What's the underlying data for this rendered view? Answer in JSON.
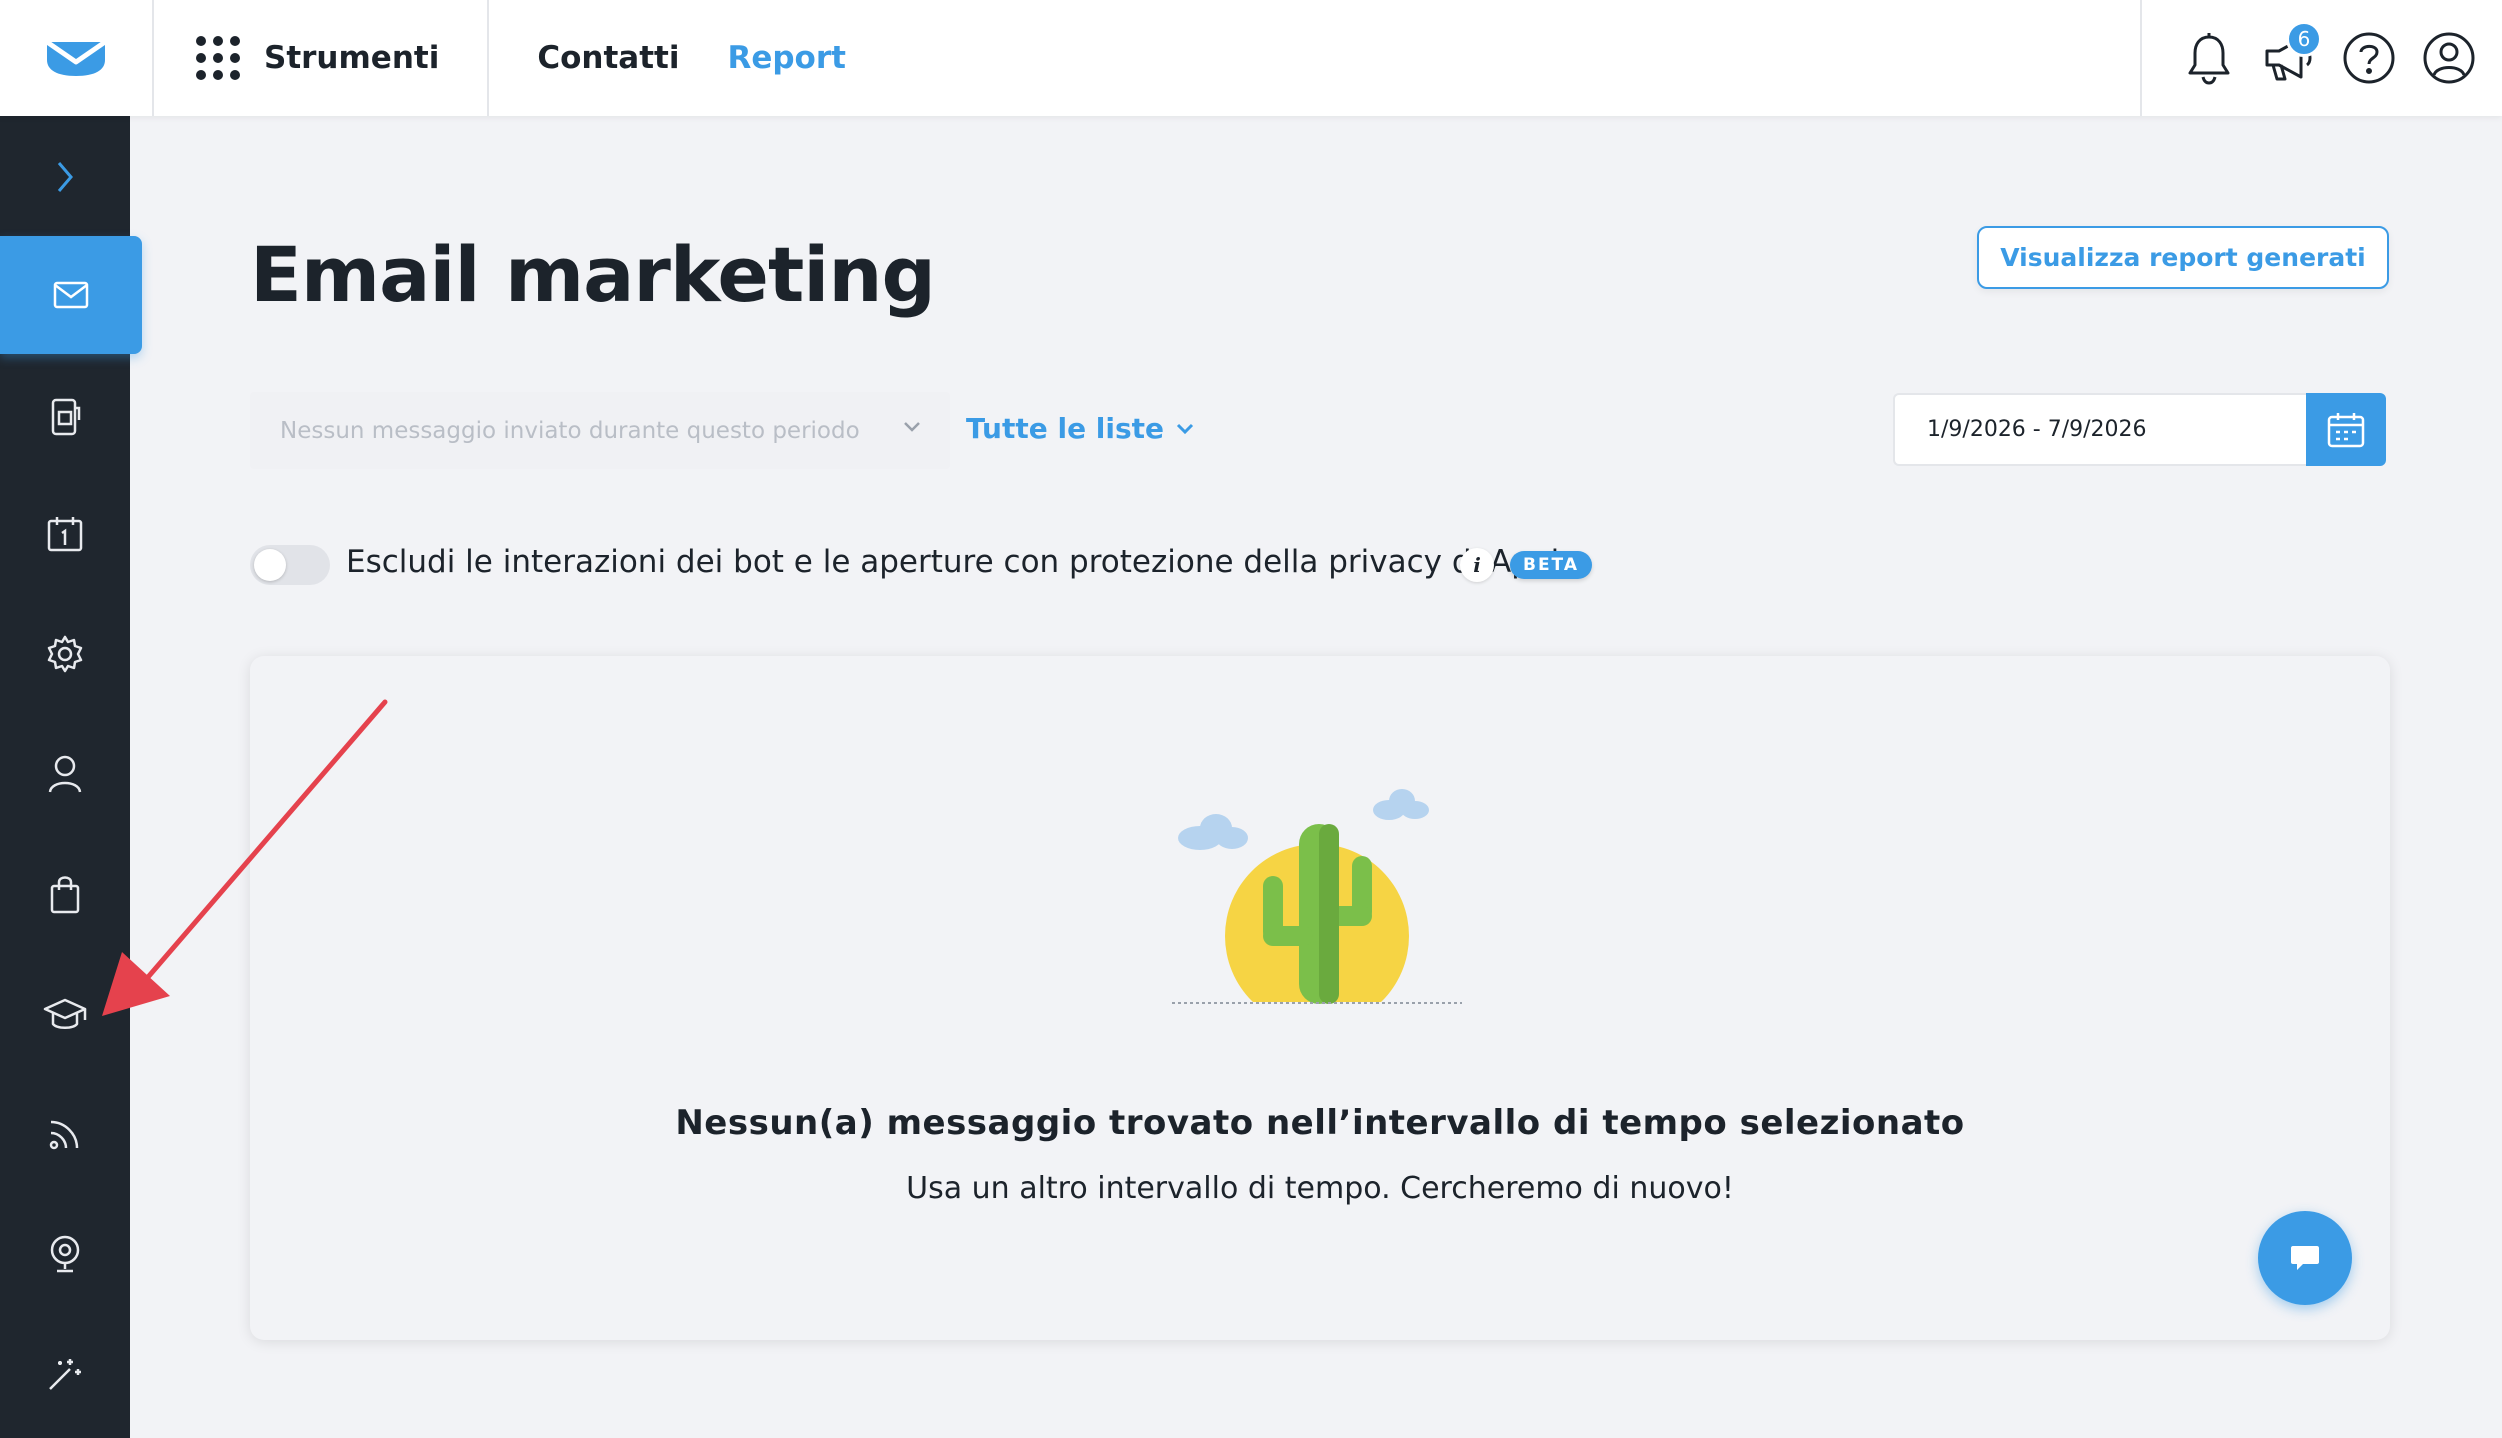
{
  "topbar": {
    "tools_label": "Strumenti",
    "nav": [
      {
        "label": "Contatti"
      },
      {
        "label": "Report"
      }
    ],
    "notifications_badge": "6"
  },
  "page": {
    "title": "Email marketing",
    "view_reports_button": "Visualizza report generati"
  },
  "filters": {
    "message_select_placeholder": "Nessun messaggio inviato durante questo periodo",
    "lists_dropdown": "Tutte le liste",
    "date_range": "1/9/2026 - 7/9/2026"
  },
  "privacy_toggle": {
    "label": "Escludi le interazioni dei bot e le aperture con protezione della privacy di Apple",
    "info_glyph": "i",
    "badge": "BETA"
  },
  "empty_state": {
    "title": "Nessun(a) messaggio trovato nell’intervallo di tempo selezionato",
    "subtitle": "Usa un altro intervallo di tempo. Cercheremo di nuovo!"
  },
  "colors": {
    "accent": "#3b9be5",
    "sidebar": "#1f262e",
    "background": "#f2f3f6",
    "annotation_arrow": "#e5424d"
  },
  "sidebar": {
    "items": [
      {
        "icon": "chevron-right-icon"
      },
      {
        "icon": "email-icon",
        "active": true
      },
      {
        "icon": "landing-page-icon"
      },
      {
        "icon": "calendar-icon"
      },
      {
        "icon": "automation-gear-icon"
      },
      {
        "icon": "contacts-user-icon"
      },
      {
        "icon": "shopping-bag-icon"
      },
      {
        "icon": "graduation-cap-icon"
      },
      {
        "icon": "rss-icon"
      },
      {
        "icon": "webinar-icon"
      },
      {
        "icon": "magic-wand-icon"
      }
    ]
  }
}
